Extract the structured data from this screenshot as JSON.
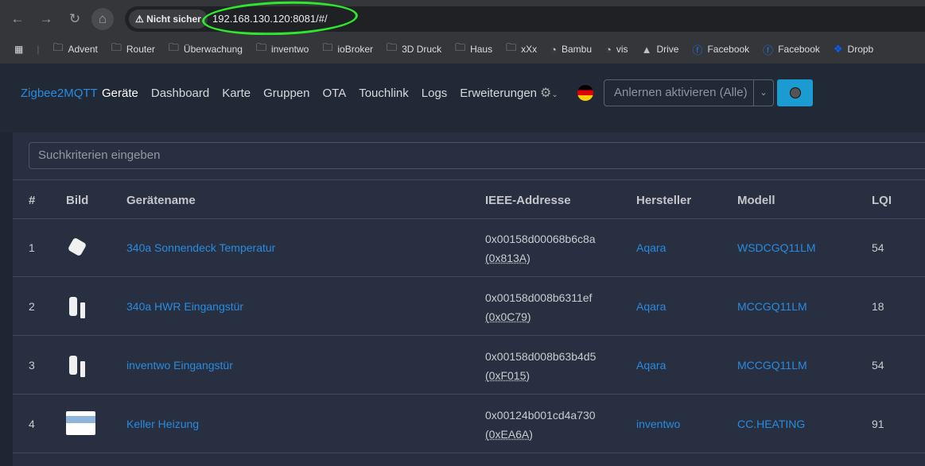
{
  "browser": {
    "security_label": "Nicht sicher",
    "url": "192.168.130.120:8081/#/",
    "bookmarks": [
      {
        "label": "Advent",
        "icon": "folder-icon"
      },
      {
        "label": "Router",
        "icon": "folder-icon"
      },
      {
        "label": "Überwachung",
        "icon": "folder-icon"
      },
      {
        "label": "inventwo",
        "icon": "folder-icon"
      },
      {
        "label": "ioBroker",
        "icon": "folder-icon"
      },
      {
        "label": "3D Druck",
        "icon": "folder-icon"
      },
      {
        "label": "Haus",
        "icon": "folder-icon"
      },
      {
        "label": "xXx",
        "icon": "folder-icon"
      },
      {
        "label": "Bambu",
        "icon": "gauge-icon"
      },
      {
        "label": "vis",
        "icon": "gauge-icon"
      },
      {
        "label": "Drive",
        "icon": "drive-icon"
      },
      {
        "label": "Facebook",
        "icon": "facebook-icon"
      },
      {
        "label": "Facebook",
        "icon": "facebook-icon"
      },
      {
        "label": "Dropb",
        "icon": "dropbox-icon"
      }
    ]
  },
  "nav": {
    "brand": "Zigbee2MQTT",
    "links": [
      "Geräte",
      "Dashboard",
      "Karte",
      "Gruppen",
      "OTA",
      "Touchlink",
      "Logs",
      "Erweiterungen"
    ],
    "permit_join": "Anlernen aktivieren (Alle)"
  },
  "search": {
    "placeholder": "Suchkriterien eingeben"
  },
  "table": {
    "headers": [
      "#",
      "Bild",
      "Gerätename",
      "IEEE-Addresse",
      "Hersteller",
      "Modell",
      "LQI"
    ],
    "rows": [
      {
        "num": "1",
        "name": "340a Sonnendeck Temperatur",
        "ieee": "0x00158d00068b6c8a",
        "nwk": "(0x813A)",
        "vendor": "Aqara",
        "model": "WSDCGQ11LM",
        "lqi": "54"
      },
      {
        "num": "2",
        "name": "340a HWR Eingangstür",
        "ieee": "0x00158d008b6311ef",
        "nwk": "(0x0C79)",
        "vendor": "Aqara",
        "model": "MCCGQ11LM",
        "lqi": "18"
      },
      {
        "num": "3",
        "name": "inventwo Eingangstür",
        "ieee": "0x00158d008b63b4d5",
        "nwk": "(0xF015)",
        "vendor": "Aqara",
        "model": "MCCGQ11LM",
        "lqi": "54"
      },
      {
        "num": "4",
        "name": "Keller Heizung",
        "ieee": "0x00124b001cd4a730",
        "nwk": "(0xEA6A)",
        "vendor": "inventwo",
        "model": "CC.HEATING",
        "lqi": "91"
      }
    ]
  }
}
